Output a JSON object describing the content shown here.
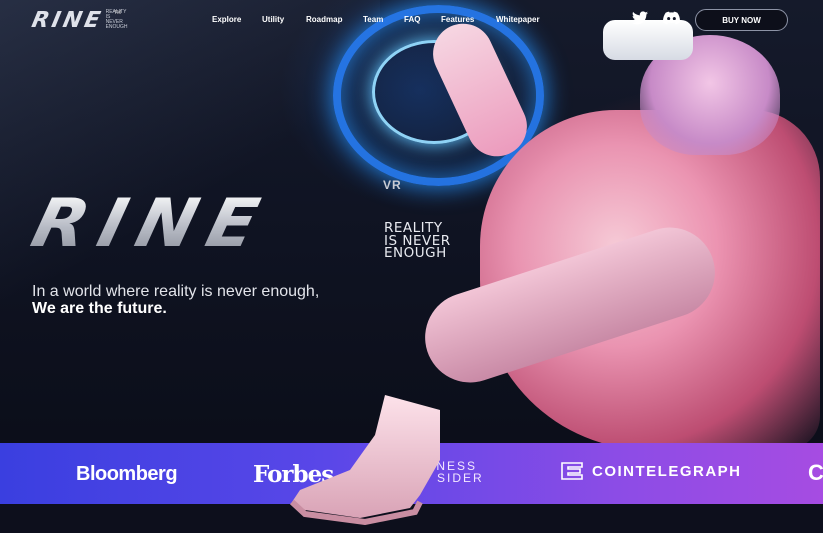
{
  "nav": {
    "logo": {
      "wordmark": "RINE",
      "tagline_small": "REALITY IS NEVER ENOUGH",
      "tm": "TM"
    },
    "links": [
      "Explore",
      "Utility",
      "Roadmap",
      "Team",
      "FAQ",
      "Features",
      "Whitepaper"
    ],
    "social": [
      {
        "name": "twitter-icon"
      },
      {
        "name": "discord-icon"
      }
    ],
    "buy_label": "BUY NOW"
  },
  "hero": {
    "logo_word": "RINE",
    "vr": "VR",
    "tagline_lines": [
      "REALITY",
      "IS NEVER",
      "ENOUGH"
    ],
    "line1": "In a world where reality is never enough,",
    "line2": "We are the future."
  },
  "press": {
    "bloomberg": "Bloomberg",
    "forbes": "Forbes",
    "business_insider_line1": "INESS",
    "business_insider_line2": "SIDER",
    "cointelegraph": "COINTELEGRAPH",
    "cut_logo": "C"
  },
  "colors": {
    "band_start": "#3a3fe0",
    "band_end": "#a64ce2",
    "background": "#0b0d18"
  }
}
